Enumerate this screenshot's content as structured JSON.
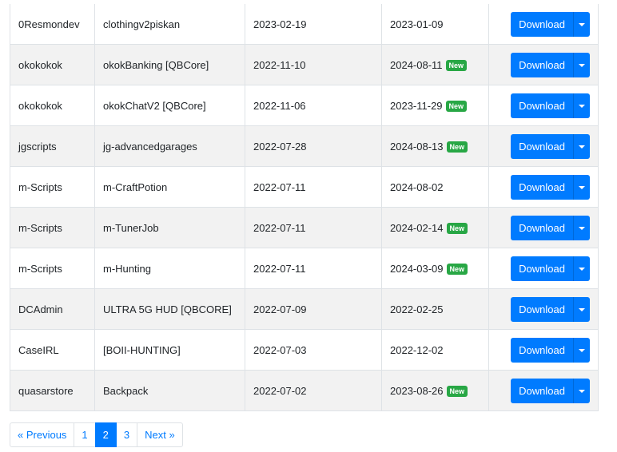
{
  "table": {
    "rows": [
      {
        "author": "0Resmondev",
        "name": "clothingv2piskan",
        "created": "2023-02-19",
        "updated": "2023-01-09",
        "is_new": false
      },
      {
        "author": "okokokok",
        "name": "okokBanking [QBCore]",
        "created": "2022-11-10",
        "updated": "2024-08-11",
        "is_new": true
      },
      {
        "author": "okokokok",
        "name": "okokChatV2 [QBCore]",
        "created": "2022-11-06",
        "updated": "2023-11-29",
        "is_new": true
      },
      {
        "author": "jgscripts",
        "name": "jg-advancedgarages",
        "created": "2022-07-28",
        "updated": "2024-08-13",
        "is_new": true
      },
      {
        "author": "m-Scripts",
        "name": "m-CraftPotion",
        "created": "2022-07-11",
        "updated": "2024-08-02",
        "is_new": false
      },
      {
        "author": "m-Scripts",
        "name": "m-TunerJob",
        "created": "2022-07-11",
        "updated": "2024-02-14",
        "is_new": true
      },
      {
        "author": "m-Scripts",
        "name": "m-Hunting",
        "created": "2022-07-11",
        "updated": "2024-03-09",
        "is_new": true
      },
      {
        "author": "DCAdmin",
        "name": "ULTRA 5G HUD [QBCORE]",
        "created": "2022-07-09",
        "updated": "2022-02-25",
        "is_new": false
      },
      {
        "author": "CaseIRL",
        "name": "[BOII-HUNTING]",
        "created": "2022-07-03",
        "updated": "2022-12-02",
        "is_new": false
      },
      {
        "author": "quasarstore",
        "name": "Backpack",
        "created": "2022-07-02",
        "updated": "2023-08-26",
        "is_new": true
      }
    ],
    "new_badge_label": "New",
    "download_label": "Download",
    "caret_icon": "chevron-down-icon"
  },
  "pagination": {
    "previous_label": "« Previous",
    "next_label": "Next »",
    "pages": [
      "1",
      "2",
      "3"
    ],
    "active_page": "2"
  },
  "colors": {
    "primary": "#007bff",
    "badge_green": "#28a745",
    "stripe": "#f2f2f2",
    "border": "#dee2e6"
  }
}
